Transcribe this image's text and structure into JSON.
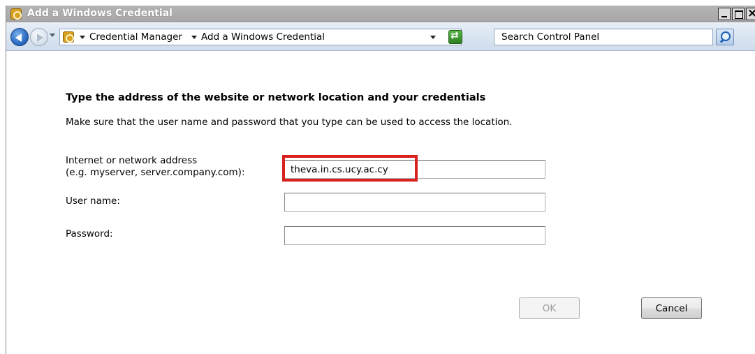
{
  "window": {
    "title": "Add a Windows Credential"
  },
  "navbar": {
    "breadcrumbs": [
      "Credential Manager",
      "Add a Windows Credential"
    ],
    "search_placeholder": "Search Control Panel"
  },
  "form": {
    "heading": "Type the address of the website or network location and your credentials",
    "description": "Make sure that the user name and password that you type can be used to access the location.",
    "address_label_line1": "Internet or network address",
    "address_label_line2": "(e.g. myserver, server.company.com):",
    "address_value": "theva.in.cs.ucy.ac.cy",
    "username_label": "User name:",
    "username_value": "",
    "password_label": "Password:",
    "password_value": ""
  },
  "buttons": {
    "ok_label": "OK",
    "cancel_label": "Cancel"
  },
  "colors": {
    "highlight": "#d9211e",
    "titlebar": "#a7a7a7",
    "navbar": "#cfdcec"
  },
  "icons": {
    "title": "credential-manager-icon",
    "back": "back-arrow-icon",
    "forward": "forward-arrow-icon",
    "refresh": "refresh-icon",
    "search": "search-icon"
  }
}
